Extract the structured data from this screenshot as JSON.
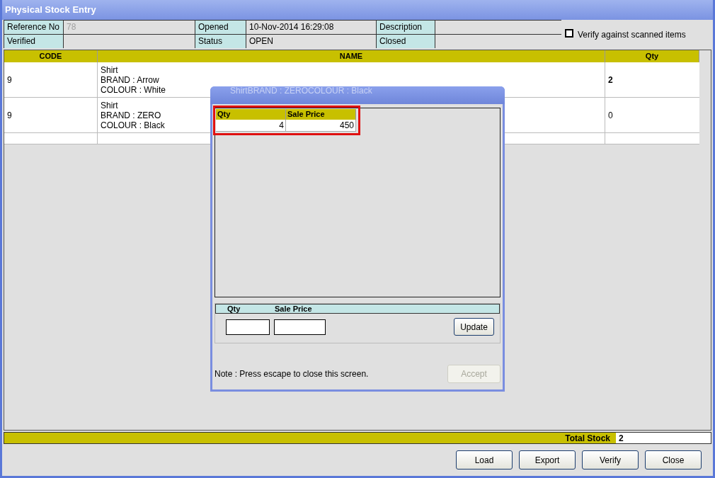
{
  "window": {
    "title": "Physical Stock Entry"
  },
  "header": {
    "fields": [
      {
        "label": "Reference No",
        "value": "78",
        "muted": true
      },
      {
        "label": "Opened",
        "value": "10-Nov-2014 16:29:08",
        "muted": false
      },
      {
        "label": "Description"
      },
      {
        "label": "Verified"
      },
      {
        "label": "Status",
        "value": "OPEN",
        "muted": false
      },
      {
        "label": "Closed"
      }
    ],
    "verify_checkbox": {
      "label": "Verify against scanned items",
      "checked": false
    }
  },
  "table": {
    "columns": [
      "CODE",
      "NAME",
      "Qty"
    ],
    "rows": [
      {
        "code": "9",
        "name": [
          "Shirt",
          "BRAND : Arrow",
          "COLOUR : White"
        ],
        "qty": "2",
        "selected": true
      },
      {
        "code": "9",
        "name": [
          "Shirt",
          "BRAND : ZERO",
          "COLOUR : Black"
        ],
        "qty": "0",
        "selected": false
      }
    ]
  },
  "total": {
    "label": "Total Stock",
    "value": "2"
  },
  "buttons": [
    {
      "label": "Load"
    },
    {
      "label": "Export"
    },
    {
      "label": "Verify"
    },
    {
      "label": "Close"
    }
  ],
  "dialog": {
    "title": "ShirtBRAND : ZEROCOLOUR : Black",
    "grid": {
      "columns": [
        "Qty",
        "Sale Price"
      ],
      "rows": [
        [
          "4",
          "450"
        ]
      ],
      "highlighted": true
    },
    "entry": {
      "columns": [
        "Qty",
        "Sale Price"
      ],
      "update_button": "Update"
    },
    "note": "Note : Press escape to close this screen.",
    "accept_button": {
      "label": "Accept",
      "disabled": true
    }
  }
}
